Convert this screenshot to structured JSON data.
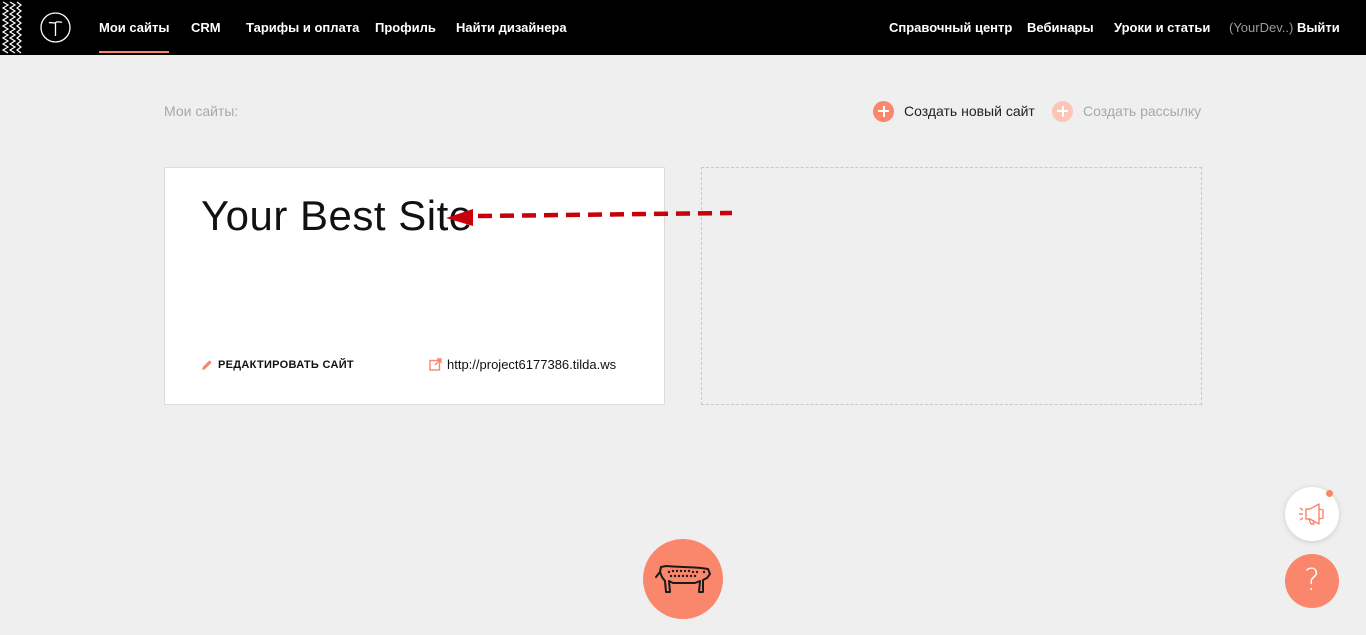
{
  "topnav": {
    "left": [
      {
        "label": "Мои сайты",
        "active": true
      },
      {
        "label": "CRM"
      },
      {
        "label": "Тарифы и оплата"
      },
      {
        "label": "Профиль"
      },
      {
        "label": "Найти дизайнера"
      }
    ],
    "right": [
      {
        "label": "Справочный центр"
      },
      {
        "label": "Вебинары"
      },
      {
        "label": "Уроки и статьи"
      }
    ],
    "user": "(YourDev..)",
    "logout": "Выйти"
  },
  "section": {
    "title": "Мои сайты:",
    "create_site": "Создать новый сайт",
    "create_mailing": "Создать рассылку"
  },
  "site_card": {
    "title": "Your Best Site",
    "edit_label": "РЕДАКТИРОВАТЬ САЙТ",
    "url": "http://project6177386.tilda.ws"
  },
  "help": {
    "label": "?"
  },
  "icons": [
    "tilda-logo-icon",
    "plus-circle-icon",
    "pencil-icon",
    "external-link-icon",
    "megaphone-icon",
    "question-icon",
    "mascot-icon"
  ],
  "colors": {
    "accent": "#fa876b",
    "topbar": "#000000",
    "background": "#efefef",
    "annotation_arrow": "#c8000a"
  }
}
